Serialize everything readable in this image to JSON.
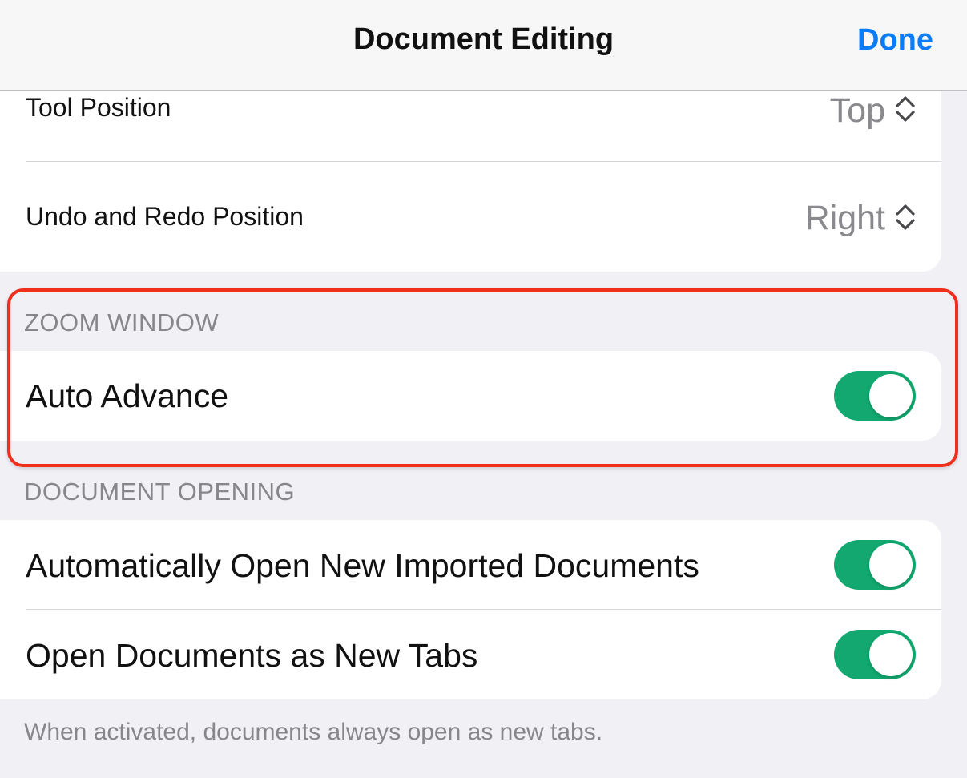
{
  "header": {
    "title": "Document Editing",
    "done_label": "Done"
  },
  "toolbar_section": {
    "rows": [
      {
        "label": "Tool Position",
        "value": "Top",
        "icon": "chevron-updown-icon"
      },
      {
        "label": "Undo and Redo Position",
        "value": "Right",
        "icon": "chevron-updown-icon"
      }
    ]
  },
  "zoom_section": {
    "header": "ZOOM WINDOW",
    "rows": [
      {
        "label": "Auto Advance",
        "toggle_on": true
      }
    ]
  },
  "opening_section": {
    "header": "DOCUMENT OPENING",
    "rows": [
      {
        "label": "Automatically Open New Imported Documents",
        "toggle_on": true
      },
      {
        "label": "Open Documents as New Tabs",
        "toggle_on": true
      }
    ],
    "footer": "When activated, documents always open as new tabs."
  },
  "colors": {
    "accent": "#0a7cf6",
    "toggle_on": "#12a86f",
    "highlight": "#ef2f1c"
  }
}
